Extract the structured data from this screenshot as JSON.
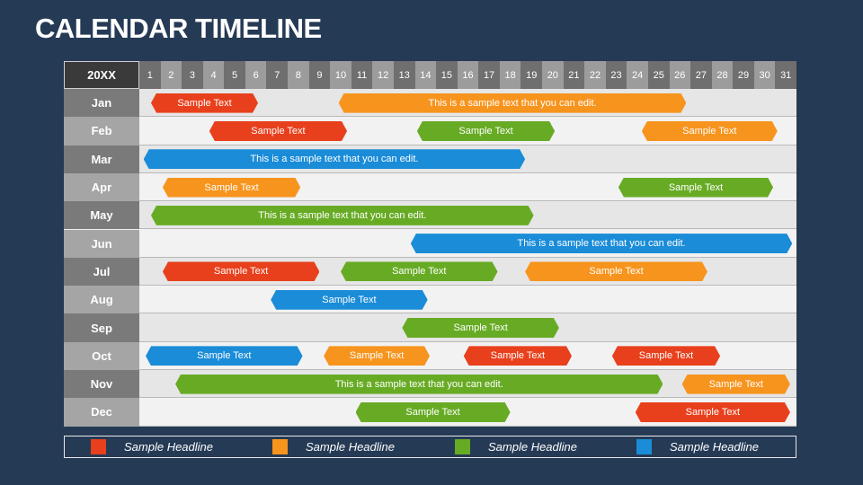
{
  "title": "CALENDAR TIMELINE",
  "colors": {
    "red": "#e8401c",
    "orange": "#f7941d",
    "green": "#67ab24",
    "blue": "#1a8cd8",
    "month_dark": "#7a7a7a",
    "month_light": "#a5a5a5",
    "day_dark": "#6f6f6f",
    "day_light": "#9c9c9c",
    "row_a": "#e6e6e6",
    "row_b": "#f2f2f2"
  },
  "chart_data": {
    "type": "timeline",
    "title": "CALENDAR TIMELINE",
    "year_label": "20XX",
    "days": [
      "1",
      "2",
      "3",
      "4",
      "5",
      "6",
      "7",
      "8",
      "9",
      "10",
      "11",
      "12",
      "13",
      "14",
      "15",
      "16",
      "17",
      "18",
      "19",
      "20",
      "21",
      "22",
      "23",
      "24",
      "25",
      "26",
      "27",
      "28",
      "29",
      "30",
      "31"
    ],
    "months": [
      "Jan",
      "Feb",
      "Mar",
      "Apr",
      "May",
      "Jun",
      "Jul",
      "Aug",
      "Sep",
      "Oct",
      "Nov",
      "Dec"
    ],
    "bars": [
      {
        "month": 0,
        "start": 0.55,
        "end": 5.6,
        "color": "red",
        "label": "Sample Text"
      },
      {
        "month": 0,
        "start": 9.4,
        "end": 25.8,
        "color": "orange",
        "label": "This is a sample text that you can edit."
      },
      {
        "month": 1,
        "start": 3.3,
        "end": 9.8,
        "color": "red",
        "label": "Sample Text"
      },
      {
        "month": 1,
        "start": 13.1,
        "end": 19.6,
        "color": "green",
        "label": "Sample Text"
      },
      {
        "month": 1,
        "start": 23.7,
        "end": 30.1,
        "color": "orange",
        "label": "Sample Text"
      },
      {
        "month": 2,
        "start": 0.2,
        "end": 18.2,
        "color": "blue",
        "label": "This is a sample text that you can edit."
      },
      {
        "month": 3,
        "start": 1.1,
        "end": 7.6,
        "color": "orange",
        "label": "Sample Text"
      },
      {
        "month": 3,
        "start": 22.6,
        "end": 29.9,
        "color": "green",
        "label": "Sample Text"
      },
      {
        "month": 4,
        "start": 0.55,
        "end": 18.6,
        "color": "green",
        "label": "This is a sample text that you can edit."
      },
      {
        "month": 5,
        "start": 12.8,
        "end": 30.8,
        "color": "blue",
        "label": "This is a sample text that you can edit."
      },
      {
        "month": 6,
        "start": 1.1,
        "end": 8.5,
        "color": "red",
        "label": "Sample Text"
      },
      {
        "month": 6,
        "start": 9.5,
        "end": 16.9,
        "color": "green",
        "label": "Sample Text"
      },
      {
        "month": 6,
        "start": 18.2,
        "end": 26.8,
        "color": "orange",
        "label": "Sample Text"
      },
      {
        "month": 7,
        "start": 6.2,
        "end": 13.6,
        "color": "blue",
        "label": "Sample Text"
      },
      {
        "month": 8,
        "start": 12.4,
        "end": 19.8,
        "color": "green",
        "label": "Sample Text"
      },
      {
        "month": 9,
        "start": 0.3,
        "end": 7.7,
        "color": "blue",
        "label": "Sample Text"
      },
      {
        "month": 9,
        "start": 8.7,
        "end": 13.7,
        "color": "orange",
        "label": "Sample Text"
      },
      {
        "month": 9,
        "start": 15.3,
        "end": 20.4,
        "color": "red",
        "label": "Sample Text"
      },
      {
        "month": 9,
        "start": 22.3,
        "end": 27.4,
        "color": "red",
        "label": "Sample Text"
      },
      {
        "month": 10,
        "start": 1.7,
        "end": 24.7,
        "color": "green",
        "label": "This is a sample text that you can edit."
      },
      {
        "month": 10,
        "start": 25.6,
        "end": 30.7,
        "color": "orange",
        "label": "Sample Text"
      },
      {
        "month": 11,
        "start": 10.2,
        "end": 17.5,
        "color": "green",
        "label": "Sample Text"
      },
      {
        "month": 11,
        "start": 23.4,
        "end": 30.7,
        "color": "red",
        "label": "Sample Text"
      }
    ],
    "legend": [
      {
        "color": "red",
        "label": "Sample Headline"
      },
      {
        "color": "orange",
        "label": "Sample Headline"
      },
      {
        "color": "green",
        "label": "Sample Headline"
      },
      {
        "color": "blue",
        "label": "Sample Headline"
      }
    ],
    "legend_position": "bottom"
  }
}
